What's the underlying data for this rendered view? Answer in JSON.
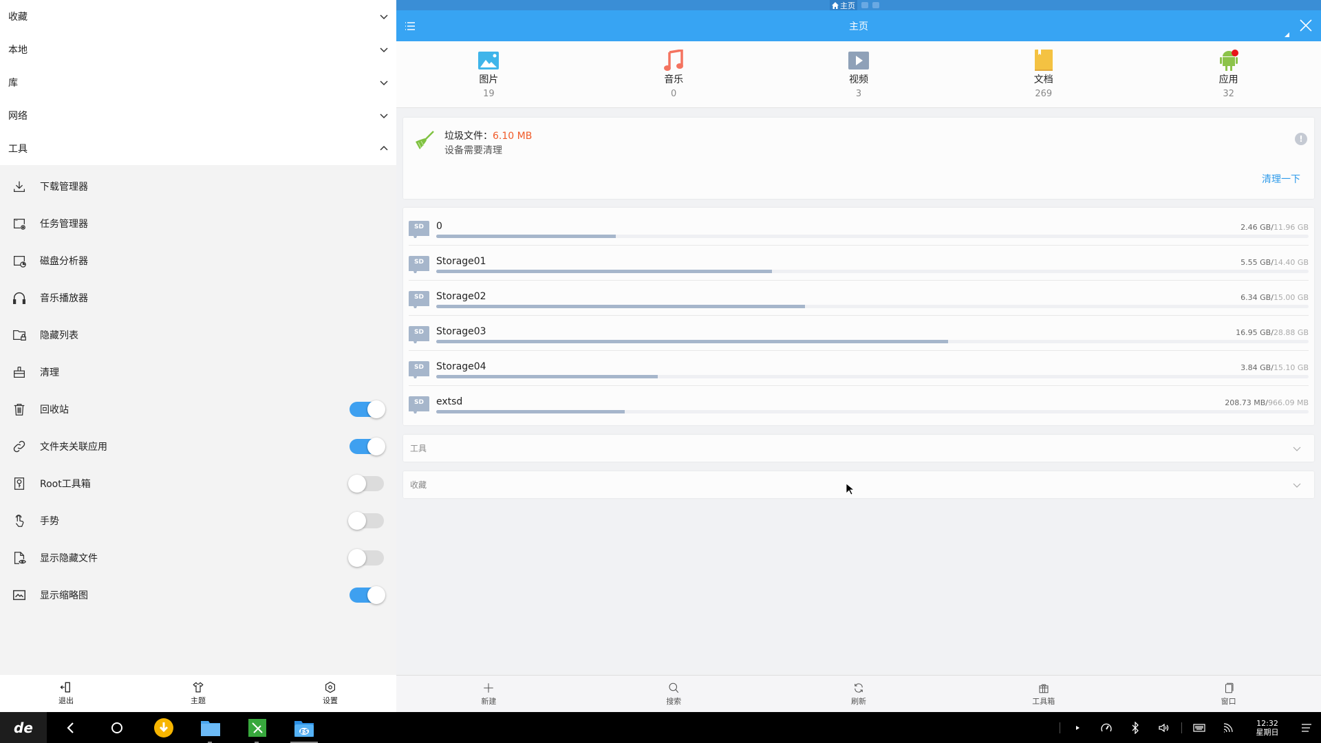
{
  "sidebar": {
    "accordion": [
      {
        "label": "收藏",
        "expanded": false
      },
      {
        "label": "本地",
        "expanded": false
      },
      {
        "label": "库",
        "expanded": false
      },
      {
        "label": "网络",
        "expanded": false
      },
      {
        "label": "工具",
        "expanded": true
      }
    ],
    "tools": [
      {
        "label": "下载管理器",
        "icon": "download-icon"
      },
      {
        "label": "任务管理器",
        "icon": "task-manager-icon"
      },
      {
        "label": "磁盘分析器",
        "icon": "disk-analyzer-icon"
      },
      {
        "label": "音乐播放器",
        "icon": "headphones-icon"
      },
      {
        "label": "隐藏列表",
        "icon": "hidden-folder-icon"
      },
      {
        "label": "清理",
        "icon": "cleaner-icon"
      },
      {
        "label": "回收站",
        "icon": "trash-icon",
        "toggle": true
      },
      {
        "label": "文件夹关联应用",
        "icon": "link-icon",
        "toggle": true
      },
      {
        "label": "Root工具箱",
        "icon": "root-icon",
        "toggle": false
      },
      {
        "label": "手势",
        "icon": "gesture-icon",
        "toggle": false
      },
      {
        "label": "显示隐藏文件",
        "icon": "show-hidden-icon",
        "toggle": false
      },
      {
        "label": "显示缩略图",
        "icon": "thumbnail-icon",
        "toggle": true
      }
    ],
    "bottom": [
      {
        "label": "退出",
        "icon": "exit-icon"
      },
      {
        "label": "主题",
        "icon": "theme-shirt-icon"
      },
      {
        "label": "设置",
        "icon": "settings-icon"
      }
    ]
  },
  "main": {
    "window_tab_label": "主页",
    "title": "主页",
    "categories": [
      {
        "label": "图片",
        "count": "19",
        "icon": "image-icon",
        "color": "#3fb5ea"
      },
      {
        "label": "音乐",
        "count": "0",
        "icon": "music-icon",
        "color": "#f4735f"
      },
      {
        "label": "视频",
        "count": "3",
        "icon": "video-icon",
        "color": "#8fa1b8"
      },
      {
        "label": "文档",
        "count": "269",
        "icon": "document-icon",
        "color": "#f4c242"
      },
      {
        "label": "应用",
        "count": "32",
        "icon": "android-icon",
        "color": "#8cc34a"
      }
    ],
    "junk": {
      "label": "垃圾文件：",
      "size": "6.10 MB",
      "subtitle": "设备需要清理",
      "info_glyph": "!",
      "clean_button": "清理一下"
    },
    "storage": [
      {
        "name": "0",
        "used": "2.46 GB",
        "total": "11.96 GB",
        "fraction": 0.206
      },
      {
        "name": "Storage01",
        "used": "5.55 GB",
        "total": "14.40 GB",
        "fraction": 0.385
      },
      {
        "name": "Storage02",
        "used": "6.34 GB",
        "total": "15.00 GB",
        "fraction": 0.423
      },
      {
        "name": "Storage03",
        "used": "16.95 GB",
        "total": "28.88 GB",
        "fraction": 0.587
      },
      {
        "name": "Storage04",
        "used": "3.84 GB",
        "total": "15.10 GB",
        "fraction": 0.254
      },
      {
        "name": "extsd",
        "used": "208.73 MB",
        "total": "966.09 MB",
        "fraction": 0.216
      }
    ],
    "sections": [
      {
        "label": "工具"
      },
      {
        "label": "收藏"
      }
    ],
    "bottom": [
      {
        "label": "新建",
        "icon": "plus-icon"
      },
      {
        "label": "搜索",
        "icon": "search-icon"
      },
      {
        "label": "刷新",
        "icon": "refresh-icon"
      },
      {
        "label": "工具箱",
        "icon": "toolbox-icon"
      },
      {
        "label": "窗口",
        "icon": "windows-icon"
      }
    ]
  },
  "taskbar": {
    "start_label": "de",
    "time": "12:32",
    "day": "星期日"
  },
  "colors": {
    "accent": "#37a4f3",
    "strip": "#3a8ed6",
    "junk_size": "#f05a28",
    "toggle_on": "#3ea0f0",
    "storage_fill": "#a6b6cb"
  }
}
